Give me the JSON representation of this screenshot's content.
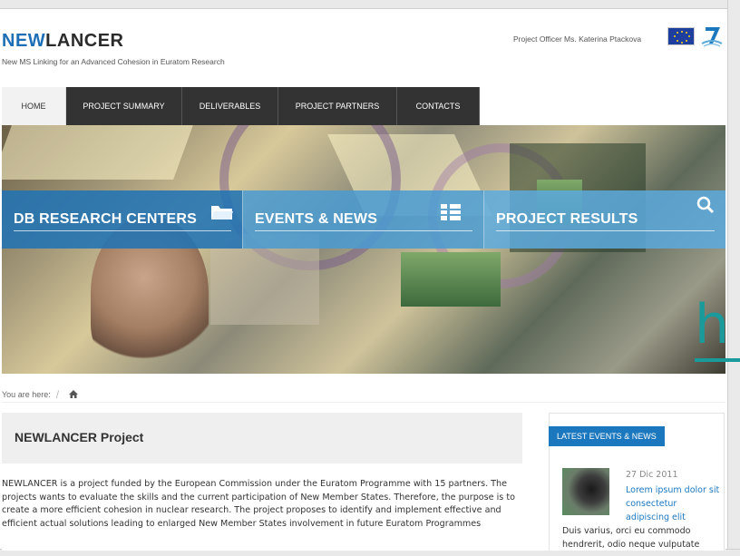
{
  "header": {
    "logo_new": "NEW",
    "logo_lancer": "LANCER",
    "tagline": "New MS Linking for an Advanced Cohesion in Euratom Research",
    "officer": "Project Officer Ms. Katerina Ptackova"
  },
  "nav": {
    "items": [
      {
        "label": "HOME",
        "active": true
      },
      {
        "label": "PROJECT SUMMARY",
        "active": false
      },
      {
        "label": "DELIVERABLES",
        "active": false
      },
      {
        "label": "PROJECT PARTNERS",
        "active": false
      },
      {
        "label": "CONTACTS",
        "active": false
      }
    ]
  },
  "tiles": [
    {
      "label": "DB RESEARCH CENTERS",
      "icon": "folder-icon"
    },
    {
      "label": "EVENTS & NEWS",
      "icon": "list-icon"
    },
    {
      "label": "PROJECT RESULTS",
      "icon": "search-icon"
    }
  ],
  "overlay": {
    "glyph": "h"
  },
  "breadcrumb": {
    "label": "You are here:",
    "separator": "/"
  },
  "main": {
    "title": "NEWLANCER Project",
    "text": "NEWLANCER is a project funded by the European Commission under the Euratom Programme with 15 partners. The projects wants to evaluate the skills and the current participation of New Member States. Therefore, the purpose is to create a more efficient cohesion in nuclear research. The project proposes to identify and implement effective and efficient actual solutions leading to enlarged New Member States involvement in future Euratom Programmes"
  },
  "sidebar": {
    "heading": "LATEST EVENTS & NEWS",
    "news": {
      "date": "27 Dic 2011",
      "link": "Lorem ipsum dolor sit consectetur adipiscing elit",
      "body": "Duis varius, orci eu commodo hendrerit, odio neque vulputate"
    }
  },
  "colors": {
    "brand_blue": "#1c6fb6",
    "nav_dark": "#333333",
    "sidebar_head": "#1b78be",
    "overlay_teal": "#1a9a9a"
  }
}
